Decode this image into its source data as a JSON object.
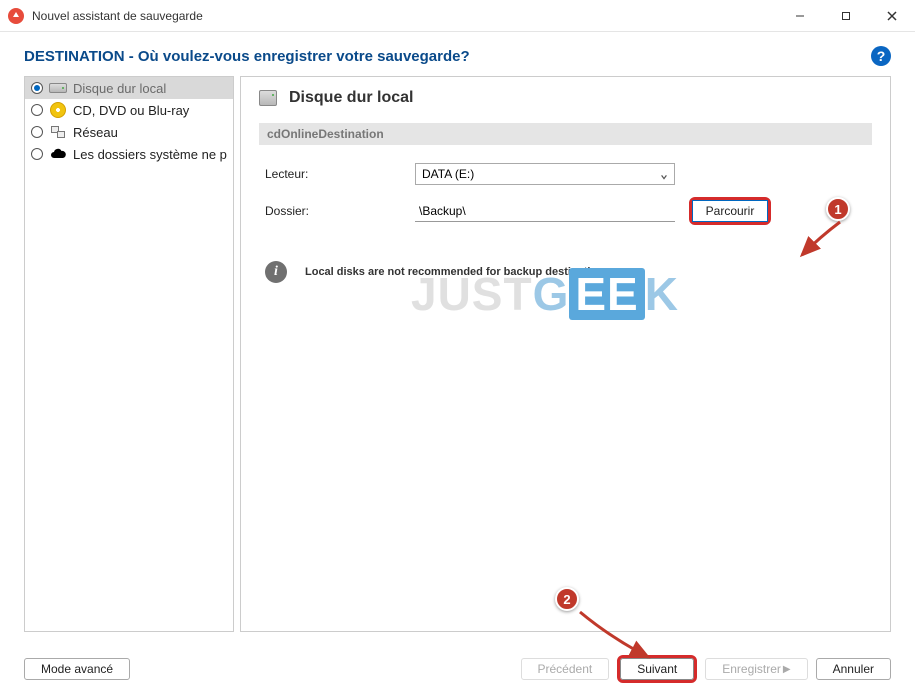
{
  "window": {
    "title": "Nouvel assistant de sauvegarde"
  },
  "header": {
    "heading": "DESTINATION - Où voulez-vous enregistrer votre sauvegarde?"
  },
  "sidebar": {
    "items": [
      {
        "label": "Disque dur local",
        "selected": true
      },
      {
        "label": "CD, DVD ou Blu-ray",
        "selected": false
      },
      {
        "label": "Réseau",
        "selected": false
      },
      {
        "label": "Les dossiers système ne p",
        "selected": false
      }
    ]
  },
  "content": {
    "title": "Disque dur local",
    "section_label": "cdOnlineDestination",
    "drive_label": "Lecteur:",
    "drive_value": "DATA (E:)",
    "folder_label": "Dossier:",
    "folder_value": "\\Backup\\",
    "browse_label": "Parcourir",
    "info_text": "Local disks are not recommended for backup destination"
  },
  "footer": {
    "mode_label": "Mode avancé",
    "prev_label": "Précédent",
    "next_label": "Suivant",
    "save_label": "Enregistrer",
    "cancel_label": "Annuler"
  },
  "annotations": {
    "badge1": "1",
    "badge2": "2"
  },
  "watermark": {
    "part1": "JUST",
    "part2": "G",
    "part3": "EE",
    "part4": "K"
  }
}
